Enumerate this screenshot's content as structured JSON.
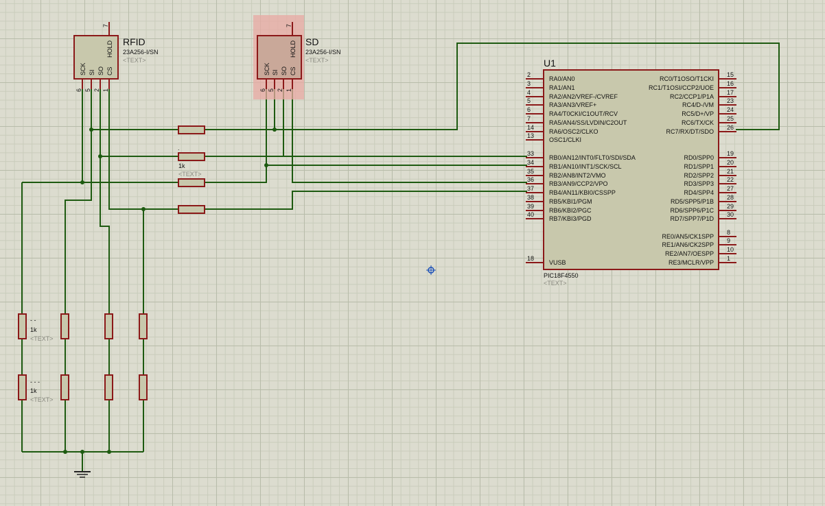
{
  "components": {
    "rfid": {
      "ref": "RFID",
      "part": "23A256-I/SN",
      "text": "<TEXT>",
      "pins_bottom": [
        "SCK",
        "SI",
        "SO",
        "CS"
      ],
      "pins_bottom_num": [
        "6",
        "5",
        "2",
        "1"
      ],
      "pin_hold": "HOLD",
      "pin_hold_num": "7"
    },
    "sd": {
      "ref": "SD",
      "part": "23A256-I/SN",
      "text": "<TEXT>",
      "pins_bottom": [
        "SCK",
        "SI",
        "SO",
        "CS"
      ],
      "pins_bottom_num": [
        "6",
        "5",
        "2",
        "1"
      ],
      "pin_hold": "HOLD",
      "pin_hold_num": "7"
    },
    "u1": {
      "ref": "U1",
      "part": "PIC18F4550",
      "text": "<TEXT>",
      "left_pins": [
        {
          "num": "2",
          "name": "RA0/AN0"
        },
        {
          "num": "3",
          "name": "RA1/AN1"
        },
        {
          "num": "4",
          "name": "RA2/AN2/VREF-/CVREF"
        },
        {
          "num": "5",
          "name": "RA3/AN3/VREF+"
        },
        {
          "num": "6",
          "name": "RA4/T0CKI/C1OUT/RCV"
        },
        {
          "num": "7",
          "name": "RA5/AN4/SS/LVDIN/C2OUT"
        },
        {
          "num": "14",
          "name": "RA6/OSC2/CLKO"
        },
        {
          "num": "13",
          "name": "OSC1/CLKI"
        },
        {
          "num": "33",
          "name": "RB0/AN12/INT0/FLT0/SDI/SDA"
        },
        {
          "num": "34",
          "name": "RB1/AN10/INT1/SCK/SCL"
        },
        {
          "num": "35",
          "name": "RB2/AN8/INT2/VMO"
        },
        {
          "num": "36",
          "name": "RB3/AN9/CCP2/VPO"
        },
        {
          "num": "37",
          "name": "RB4/AN11/KBI0/CSSPP"
        },
        {
          "num": "38",
          "name": "RB5/KBI1/PGM"
        },
        {
          "num": "39",
          "name": "RB6/KBI2/PGC"
        },
        {
          "num": "40",
          "name": "RB7/KBI3/PGD"
        },
        {
          "num": "18",
          "name": "VUSB"
        }
      ],
      "right_pins": [
        {
          "num": "15",
          "name": "RC0/T1OSO/T1CKI"
        },
        {
          "num": "16",
          "name": "RC1/T1OSI/CCP2/UOE"
        },
        {
          "num": "17",
          "name": "RC2/CCP1/P1A"
        },
        {
          "num": "23",
          "name": "RC4/D-/VM"
        },
        {
          "num": "24",
          "name": "RC5/D+/VP"
        },
        {
          "num": "25",
          "name": "RC6/TX/CK"
        },
        {
          "num": "26",
          "name": "RC7/RX/DT/SDO"
        },
        {
          "num": "19",
          "name": "RD0/SPP0"
        },
        {
          "num": "20",
          "name": "RD1/SPP1"
        },
        {
          "num": "21",
          "name": "RD2/SPP2"
        },
        {
          "num": "22",
          "name": "RD3/SPP3"
        },
        {
          "num": "27",
          "name": "RD4/SPP4"
        },
        {
          "num": "28",
          "name": "RD5/SPP5/P1B"
        },
        {
          "num": "29",
          "name": "RD6/SPP6/P1C"
        },
        {
          "num": "30",
          "name": "RD7/SPP7/P1D"
        },
        {
          "num": "8",
          "name": "RE0/AN5/CK1SPP"
        },
        {
          "num": "9",
          "name": "RE1/AN6/CK2SPP"
        },
        {
          "num": "10",
          "name": "RE2/AN7/OESPP"
        },
        {
          "num": "1",
          "name": "RE3/MCLR/VPP"
        }
      ]
    },
    "resistors": {
      "series_label_dot": ".",
      "series_value": "1k",
      "series_text": "<TEXT>",
      "pull_top_label": "- -",
      "pull_top_value": "1k",
      "pull_top_text": "<TEXT>",
      "pull_bot_label": "- - -",
      "pull_bot_value": "1k",
      "pull_bot_text": "<TEXT>"
    }
  },
  "colors": {
    "wire": "#1d5a10",
    "component_outline": "#8b1818",
    "component_fill": "#c8c8ac",
    "selection": "#e8a9a3",
    "grid": "#b8bcaa",
    "marker": "#1a4fb8"
  }
}
